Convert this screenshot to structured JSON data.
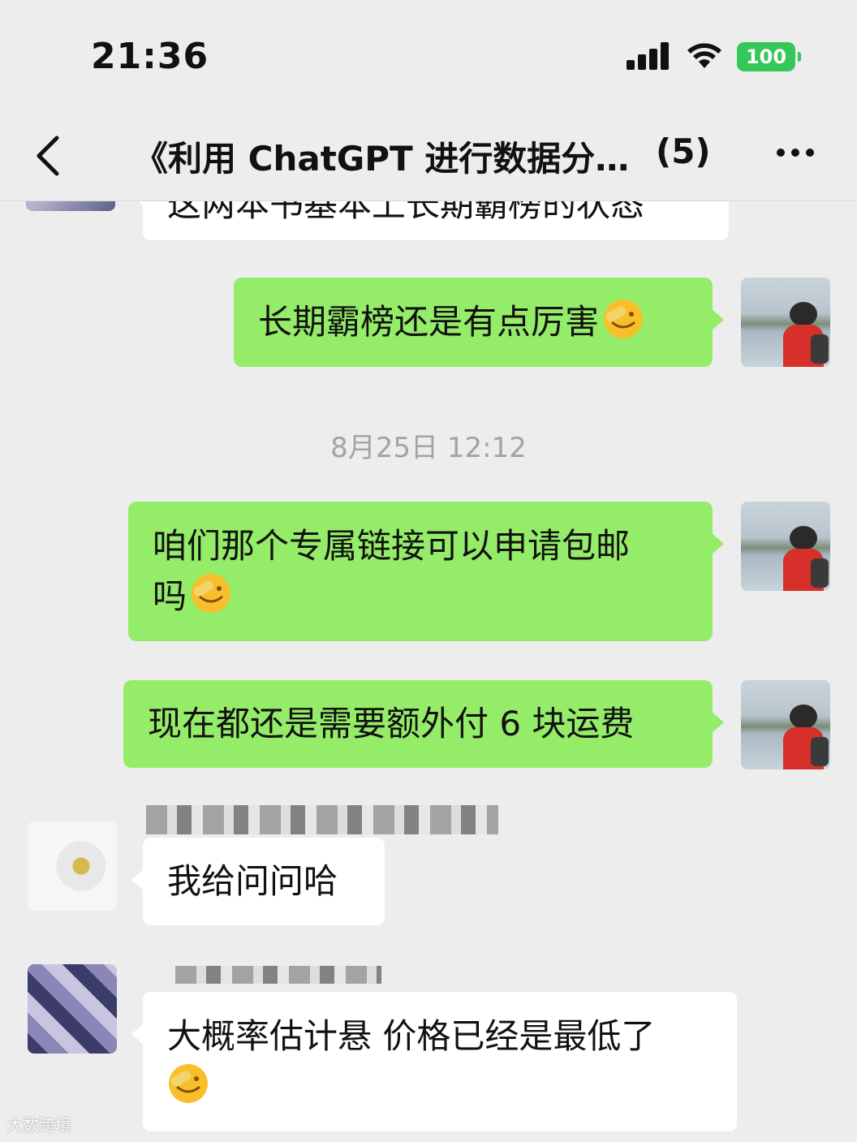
{
  "status_bar": {
    "time": "21:36",
    "battery": "100"
  },
  "nav": {
    "title": "《利用 ChatGPT 进行数据分…",
    "member_count": "(5)"
  },
  "messages": [
    {
      "side": "them",
      "text": "这两本书基本上长期霸榜的状态",
      "partial": true
    },
    {
      "side": "me",
      "text": "长期霸榜还是有点厉害",
      "emoji": "facepalm-emoji"
    },
    {
      "type": "timestamp",
      "text": "8月25日 12:12"
    },
    {
      "side": "me",
      "line1": "咱们那个专属链接可以申请包邮",
      "line2": "吗",
      "emoji": "facepalm-emoji"
    },
    {
      "side": "me",
      "text": "现在都还是需要额外付 6 块运费"
    },
    {
      "side": "them",
      "text": "我给问问哈"
    },
    {
      "side": "them",
      "text": "大概率估计悬 价格已经是最低了",
      "emoji": "facepalm-emoji"
    }
  ],
  "watermark": "大数跨境",
  "colors": {
    "self_bubble": "#95ec69",
    "other_bubble": "#ffffff",
    "background": "#ededed"
  }
}
